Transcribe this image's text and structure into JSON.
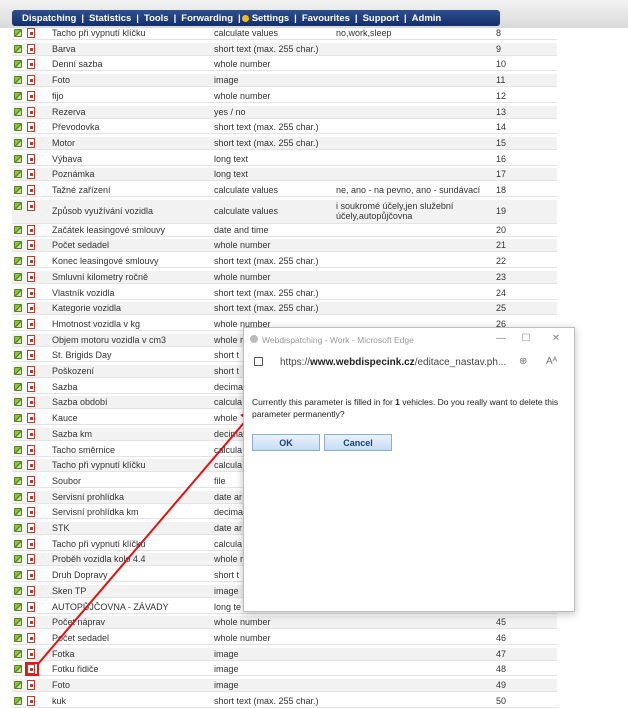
{
  "menu": {
    "items": [
      "Dispatching",
      "Statistics",
      "Tools",
      "Forwarding",
      "Settings",
      "Favourites",
      "Support",
      "Admin"
    ],
    "separator": "|"
  },
  "rows": [
    {
      "name": "Tacho při vypnutí klíčku",
      "type": "calculate values",
      "values": "no,work,sleep",
      "num": "8"
    },
    {
      "name": "Barva",
      "type": "short text (max. 255 char.)",
      "values": "",
      "num": "9"
    },
    {
      "name": "Denní sazba",
      "type": "whole number",
      "values": "",
      "num": "10"
    },
    {
      "name": "Foto",
      "type": "image",
      "values": "",
      "num": "11"
    },
    {
      "name": "fijo",
      "type": "whole number",
      "values": "",
      "num": "12"
    },
    {
      "name": "Rezerva",
      "type": "yes / no",
      "values": "",
      "num": "13"
    },
    {
      "name": "Převodovka",
      "type": "short text (max. 255 char.)",
      "values": "",
      "num": "14"
    },
    {
      "name": "Motor",
      "type": "short text (max. 255 char.)",
      "values": "",
      "num": "15"
    },
    {
      "name": "Výbava",
      "type": "long text",
      "values": "",
      "num": "16"
    },
    {
      "name": "Poznámka",
      "type": "long text",
      "values": "",
      "num": "17"
    },
    {
      "name": "Tažné zařízení",
      "type": "calculate values",
      "values": "ne, ano - na pevno, ano - sundávací",
      "num": "18"
    },
    {
      "name": "Způsob využívání vozidla",
      "type": "calculate values",
      "values": "i soukromé účely,jen služební účely,autopůjčovna",
      "num": "19"
    },
    {
      "name": "Začátek leasingové smlouvy",
      "type": "date and time",
      "values": "",
      "num": "20"
    },
    {
      "name": "Počet sedadel",
      "type": "whole number",
      "values": "",
      "num": "21"
    },
    {
      "name": "Konec leasingové smlouvy",
      "type": "short text (max. 255 char.)",
      "values": "",
      "num": "22"
    },
    {
      "name": "Smluvní kilometry ročně",
      "type": "whole number",
      "values": "",
      "num": "23"
    },
    {
      "name": "Vlastník vozidla",
      "type": "short text (max. 255 char.)",
      "values": "",
      "num": "24"
    },
    {
      "name": "Kategorie vozidla",
      "type": "short text (max. 255 char.)",
      "values": "",
      "num": "25"
    },
    {
      "name": "Hmotnost vozidla v kg",
      "type": "whole number",
      "values": "",
      "num": "26"
    },
    {
      "name": "Objem motoru vozidla v cm3",
      "type": "whole r",
      "values": "",
      "num": ""
    },
    {
      "name": "St. Brigids Day",
      "type": "short t",
      "values": "",
      "num": ""
    },
    {
      "name": "Poškození",
      "type": "short t",
      "values": "",
      "num": ""
    },
    {
      "name": "Sazba",
      "type": "decima",
      "values": "",
      "num": ""
    },
    {
      "name": "Sazba období",
      "type": "calcula",
      "values": "",
      "num": ""
    },
    {
      "name": "Kauce",
      "type": "whole",
      "values": "",
      "num": ""
    },
    {
      "name": "Sazba km",
      "type": "decima",
      "values": "",
      "num": ""
    },
    {
      "name": "Tacho směrnice",
      "type": "calcula",
      "values": "",
      "num": ""
    },
    {
      "name": "Tacho při vypnutí klíčku",
      "type": "calcula",
      "values": "",
      "num": ""
    },
    {
      "name": "Soubor",
      "type": "file",
      "values": "",
      "num": ""
    },
    {
      "name": "Servisní prohlídka",
      "type": "date ar",
      "values": "",
      "num": ""
    },
    {
      "name": "Servisní prohlídka km",
      "type": "decima",
      "values": "",
      "num": ""
    },
    {
      "name": "STK",
      "type": "date ar",
      "values": "",
      "num": ""
    },
    {
      "name": "Tacho při vypnutí klíčku",
      "type": "calcula",
      "values": "",
      "num": ""
    },
    {
      "name": "Proběh vozidla kolo 4.4",
      "type": "whole r",
      "values": "",
      "num": ""
    },
    {
      "name": "Druh Dopravy",
      "type": "short t",
      "values": "",
      "num": ""
    },
    {
      "name": "Sken TP",
      "type": "image",
      "values": "",
      "num": ""
    },
    {
      "name": "AUTOPŮJČOVNA - ZÁVADY",
      "type": "long te",
      "values": "",
      "num": ""
    },
    {
      "name": "Počet náprav",
      "type": "whole number",
      "values": "",
      "num": "45"
    },
    {
      "name": "Počet sedadel",
      "type": "whole number",
      "values": "",
      "num": "46"
    },
    {
      "name": "Fotka",
      "type": "image",
      "values": "",
      "num": "47"
    },
    {
      "name": "Fotku řidiče",
      "type": "image",
      "values": "",
      "num": "48"
    },
    {
      "name": "Foto",
      "type": "image",
      "values": "",
      "num": "49"
    },
    {
      "name": "kuk",
      "type": "short text (max. 255 char.)",
      "values": "",
      "num": "50"
    }
  ],
  "dialog": {
    "window_title": "Webdispatching - Work - Microsoft Edge",
    "url_prefix": "https://",
    "url_domain": "www.webdispecink.cz",
    "url_path": "/editace_nastav.ph...",
    "message_before": "Currently this parameter is filled in for ",
    "message_count": "1",
    "message_after": " vehicles. Do you really want to delete this parameter permanently?",
    "ok_label": "OK",
    "cancel_label": "Cancel",
    "minimize": "—",
    "maximize": "☐",
    "close": "✕",
    "zoom_icon": "⊕",
    "read_icon": "Aᴬ"
  },
  "annotation_color": "#e11111"
}
